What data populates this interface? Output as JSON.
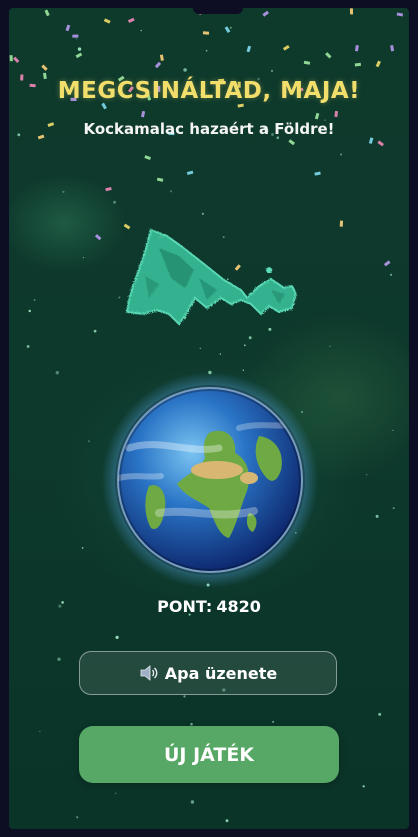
{
  "screen": {
    "title": "MEGCSINÁLTAD, MAJA!",
    "subtitle": "Kockamalac hazaért a Földre!",
    "score_label": "PONT:",
    "score_value": "4820",
    "dad_message_button": "Apa üzenete",
    "new_game_button": "ÚJ JÁTÉK"
  },
  "icons": {
    "speaker": "speaker-icon",
    "character": "cube-pig-character",
    "planet": "earth-globe"
  },
  "colors": {
    "background": "#0e3a2c",
    "title": "#f2de6a",
    "primary_button": "#57a766",
    "character": "#35b894"
  }
}
